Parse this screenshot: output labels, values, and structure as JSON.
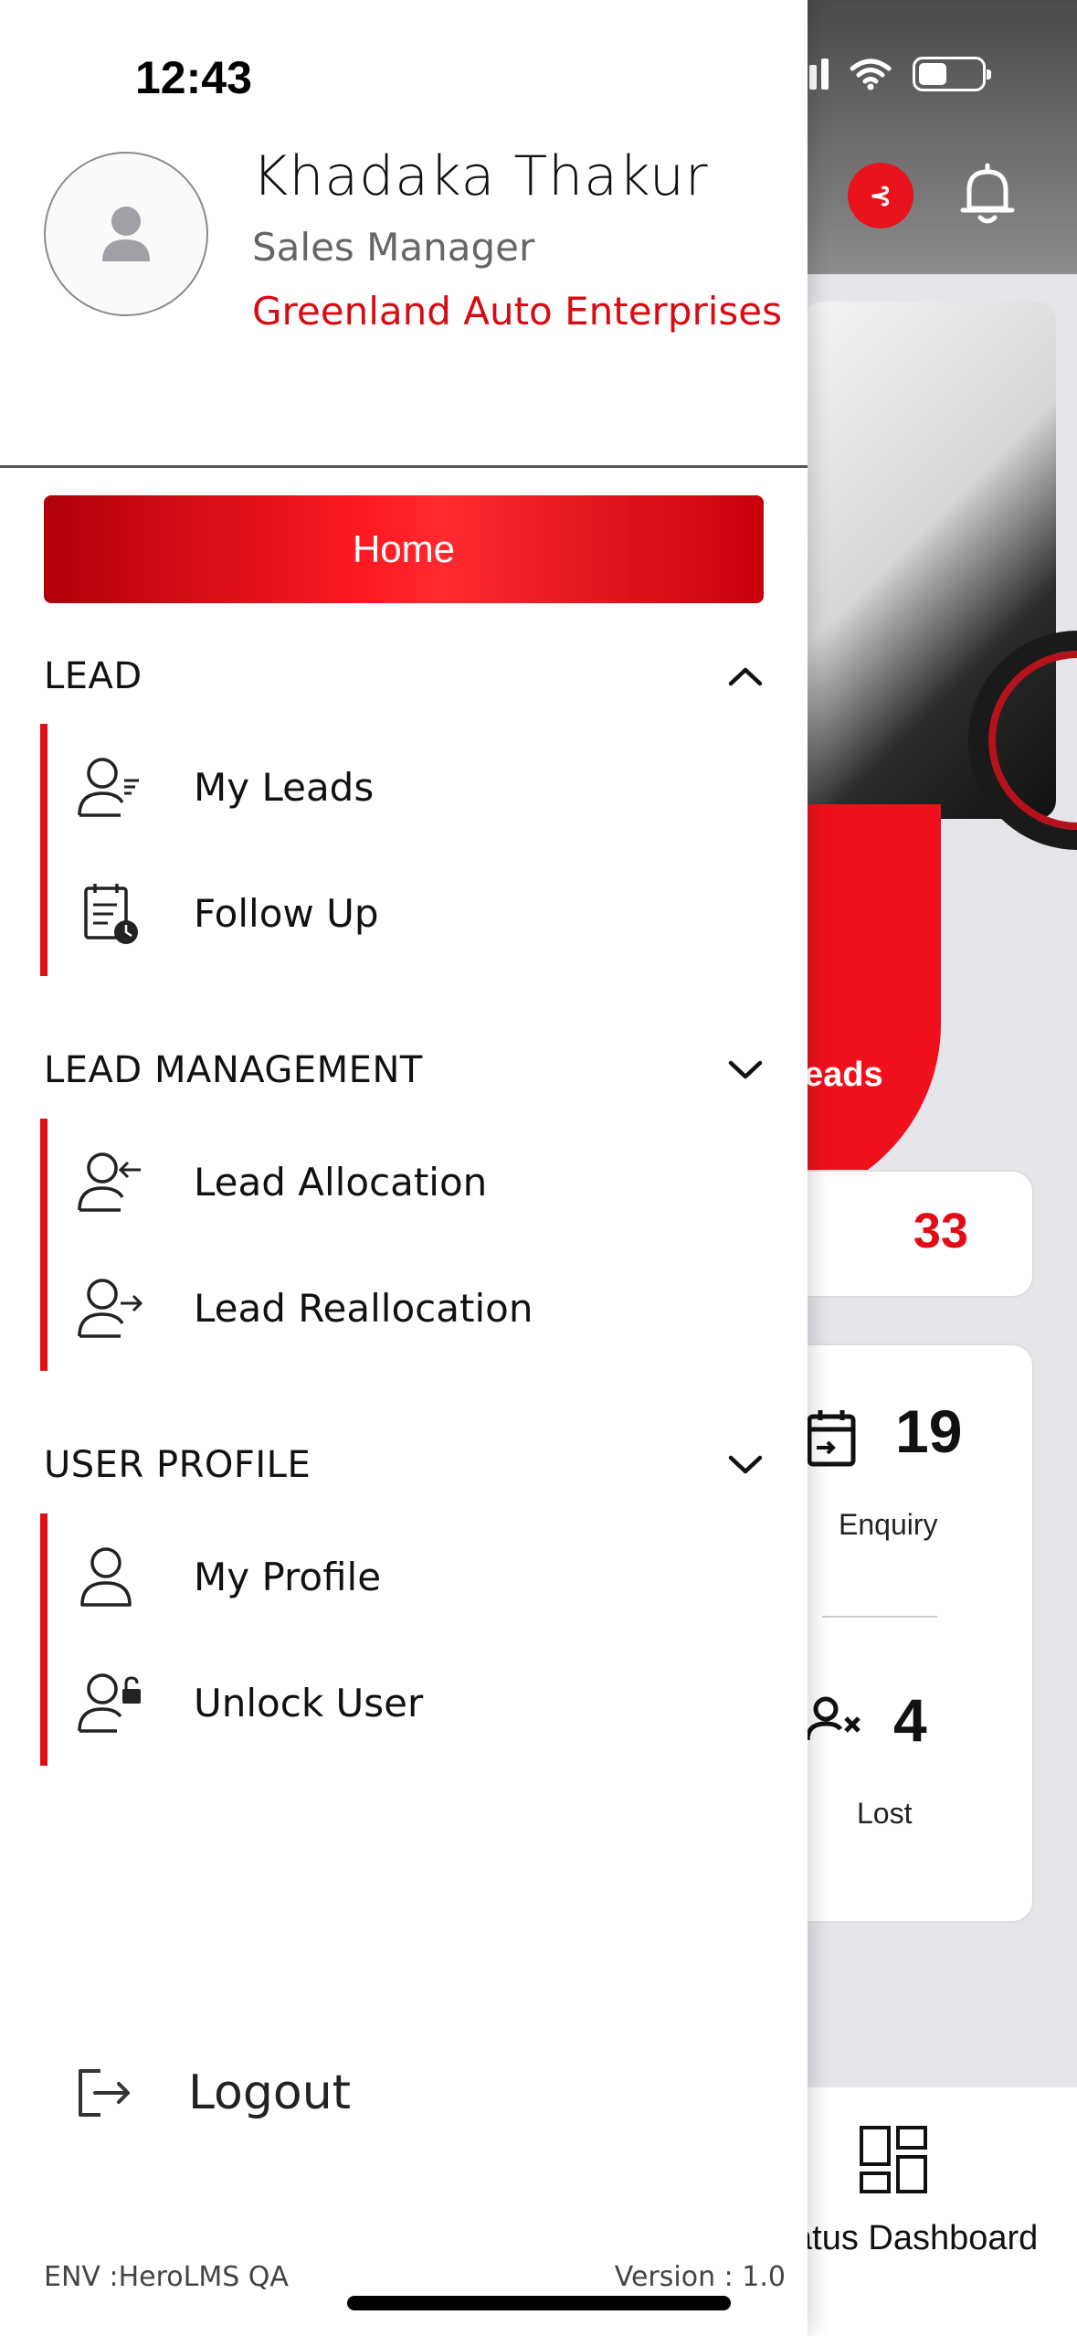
{
  "status_bar": {
    "time": "12:43"
  },
  "user": {
    "name": "Khadaka Thakur",
    "role": "Sales Manager",
    "company": "Greenland Auto Enterprises"
  },
  "menu": {
    "home_label": "Home",
    "sections": [
      {
        "title": "LEAD",
        "expanded": true,
        "items": [
          {
            "label": "My Leads",
            "icon": "user-list-icon"
          },
          {
            "label": "Follow Up",
            "icon": "calendar-clock-icon"
          }
        ]
      },
      {
        "title": "LEAD MANAGEMENT",
        "expanded": false,
        "items": [
          {
            "label": "Lead Allocation",
            "icon": "user-arrow-in-icon"
          },
          {
            "label": "Lead Reallocation",
            "icon": "user-arrow-out-icon"
          }
        ]
      },
      {
        "title": "USER PROFILE",
        "expanded": false,
        "items": [
          {
            "label": "My Profile",
            "icon": "user-icon"
          },
          {
            "label": "Unlock User",
            "icon": "user-lock-icon"
          }
        ]
      }
    ],
    "logout_label": "Logout"
  },
  "footer": {
    "env": "ENV :HeroLMS QA",
    "version": "Version : 1.0"
  },
  "background": {
    "banner_text": "eads",
    "leads_count": "33",
    "stats": [
      {
        "value": "19",
        "label": "Enquiry"
      },
      {
        "value": "4",
        "label": "Lost"
      }
    ],
    "bottom_tab_label": "atus Dashboard"
  },
  "colors": {
    "accent": "#e30d16",
    "company_text": "#d90b12"
  }
}
